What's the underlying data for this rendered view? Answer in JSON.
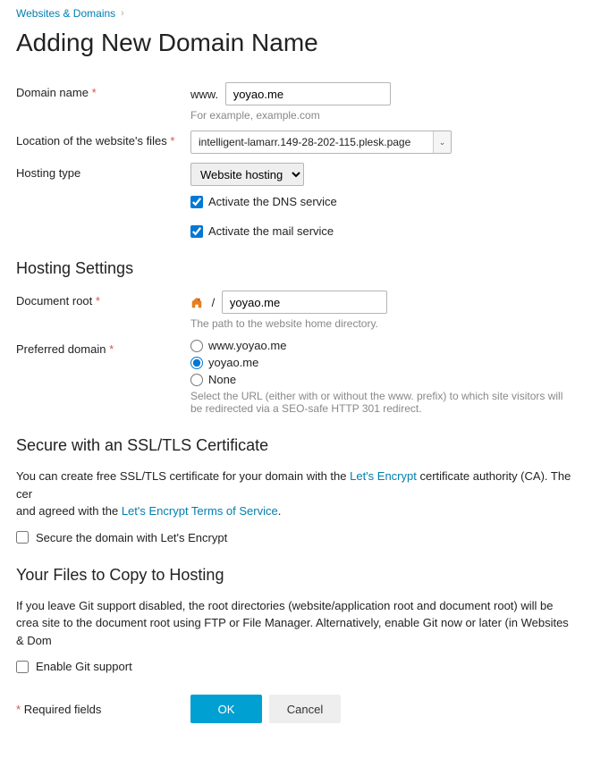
{
  "breadcrumb": {
    "link": "Websites & Domains"
  },
  "page": {
    "title": "Adding New Domain Name"
  },
  "domain": {
    "label": "Domain name",
    "prefix": "www.",
    "value": "yoyao.me",
    "hint": "For example, example.com"
  },
  "location": {
    "label": "Location of the website's files",
    "value": "intelligent-lamarr.149-28-202-115.plesk.page"
  },
  "hostingType": {
    "label": "Hosting type",
    "options": [
      "Website hosting"
    ],
    "selected": "Website hosting"
  },
  "dns": {
    "label": "Activate the DNS service",
    "checked": true
  },
  "mail": {
    "label": "Activate the mail service",
    "checked": true
  },
  "hostingSettings": {
    "heading": "Hosting Settings"
  },
  "docroot": {
    "label": "Document root",
    "value": "yoyao.me",
    "hint": "The path to the website home directory."
  },
  "preferred": {
    "label": "Preferred domain",
    "options": [
      {
        "label": "www.yoyao.me",
        "value": "www"
      },
      {
        "label": "yoyao.me",
        "value": "root"
      },
      {
        "label": "None",
        "value": "none"
      }
    ],
    "selected": "root",
    "hint": "Select the URL (either with or without the www. prefix) to which site visitors will be redirected via a SEO-safe HTTP 301 redirect."
  },
  "ssl": {
    "heading": "Secure with an SSL/TLS Certificate",
    "text1": "You can create free SSL/TLS certificate for your domain with the ",
    "link1": "Let's Encrypt",
    "text2": " certificate authority (CA). The cer",
    "text3": "and agreed with the ",
    "link2": "Let's Encrypt Terms of Service",
    "checkboxLabel": "Secure the domain with Let's Encrypt",
    "checked": false
  },
  "git": {
    "heading": "Your Files to Copy to Hosting",
    "text": "If you leave Git support disabled, the root directories (website/application root and document root) will be crea site to the document root using FTP or File Manager. Alternatively, enable Git now or later (in Websites & Dom",
    "checkboxLabel": "Enable Git support",
    "checked": false
  },
  "footer": {
    "required": "Required fields",
    "ok": "OK",
    "cancel": "Cancel"
  }
}
